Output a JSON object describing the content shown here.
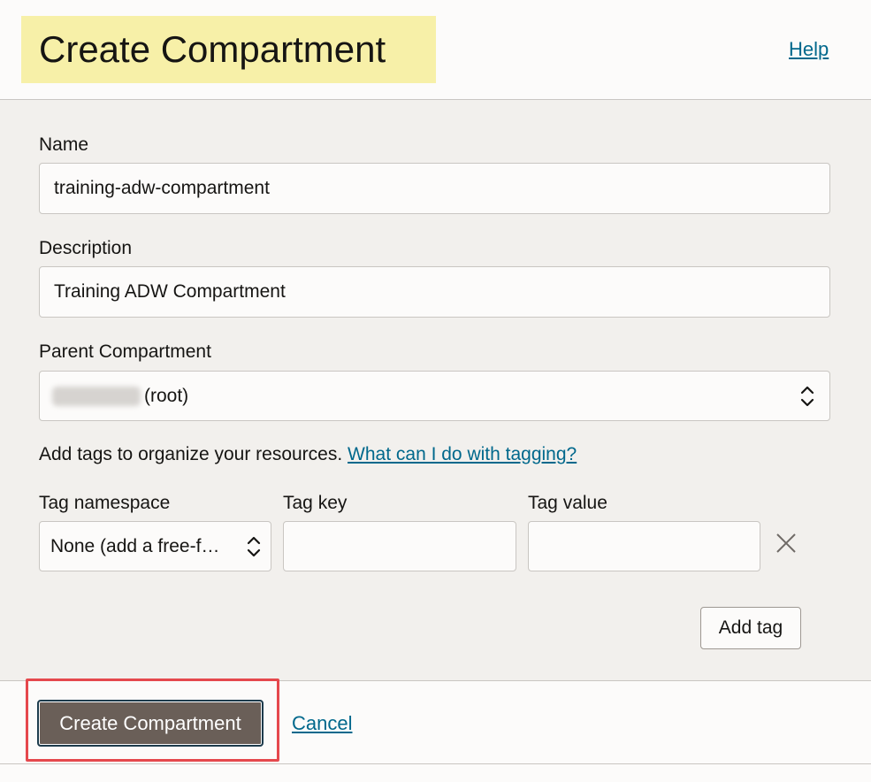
{
  "header": {
    "title": "Create Compartment",
    "help_label": "Help"
  },
  "form": {
    "name": {
      "label": "Name",
      "value": "training-adw-compartment"
    },
    "description": {
      "label": "Description",
      "value": "Training ADW Compartment"
    },
    "parent": {
      "label": "Parent Compartment",
      "value_suffix": "(root)"
    },
    "tags_intro": "Add tags to organize your resources.",
    "tags_link": "What can I do with tagging?",
    "tag_namespace": {
      "label": "Tag namespace",
      "value": "None (add a free-f…"
    },
    "tag_key": {
      "label": "Tag key",
      "value": ""
    },
    "tag_value": {
      "label": "Tag value",
      "value": ""
    },
    "add_tag_label": "Add tag"
  },
  "footer": {
    "create_label": "Create Compartment",
    "cancel_label": "Cancel"
  },
  "icons": {
    "select_chevron": "chevron-up-down-icon",
    "remove_tag": "close-icon"
  },
  "colors": {
    "title_highlight": "#f7f0a8",
    "link": "#00688c",
    "primary_button": "#6a5f58",
    "annotation_box": "#e5484d"
  }
}
